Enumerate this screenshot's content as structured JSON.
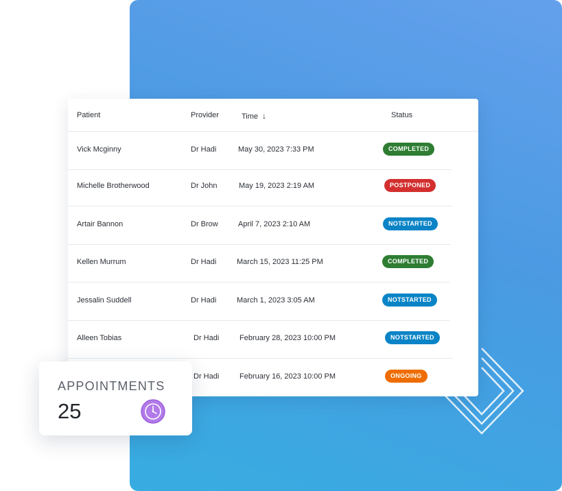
{
  "table": {
    "headers": {
      "patient": "Patient",
      "provider": "Provider",
      "time": "Time",
      "status": "Status"
    },
    "sort_icon": "arrow-down-icon",
    "rows": [
      {
        "patient": "Vick Mcginny",
        "provider": "Dr Hadi",
        "time": "May 30, 2023 7:33 PM",
        "status": "COMPLETED"
      },
      {
        "patient": "Michelle Brotherwood",
        "provider": "Dr John",
        "time": "May 19, 2023 2:19 AM",
        "status": "POSTPONED"
      },
      {
        "patient": "Artair Bannon",
        "provider": "Dr Brow",
        "time": "April 7, 2023 2:10 AM",
        "status": "NOTSTARTED"
      },
      {
        "patient": "Kellen Murrum",
        "provider": "Dr Hadi",
        "time": "March 15, 2023 11:25 PM",
        "status": "COMPLETED"
      },
      {
        "patient": "Jessalin Suddell",
        "provider": "Dr Hadi",
        "time": "March 1, 2023 3:05 AM",
        "status": "NOTSTARTED"
      },
      {
        "patient": "Alleen Tobias",
        "provider": "Dr Hadi",
        "time": "February 28, 2023 10:00 PM",
        "status": "NOTSTARTED"
      },
      {
        "patient": "",
        "provider": "Dr Hadi",
        "time": "February 16, 2023 10:00 PM",
        "status": "ONGOING"
      }
    ]
  },
  "status_colors": {
    "COMPLETED": "#2e7d32",
    "POSTPONED": "#d32f2f",
    "NOTSTARTED": "#0a84c6",
    "ONGOING": "#ef6c00"
  },
  "appointments": {
    "title": "APPOINTMENTS",
    "count": "25",
    "icon": "clock-icon",
    "icon_color": "#b27ae8"
  },
  "colors": {
    "background_gradient_start": "#64a0ec",
    "background_gradient_end": "#37ade1"
  }
}
